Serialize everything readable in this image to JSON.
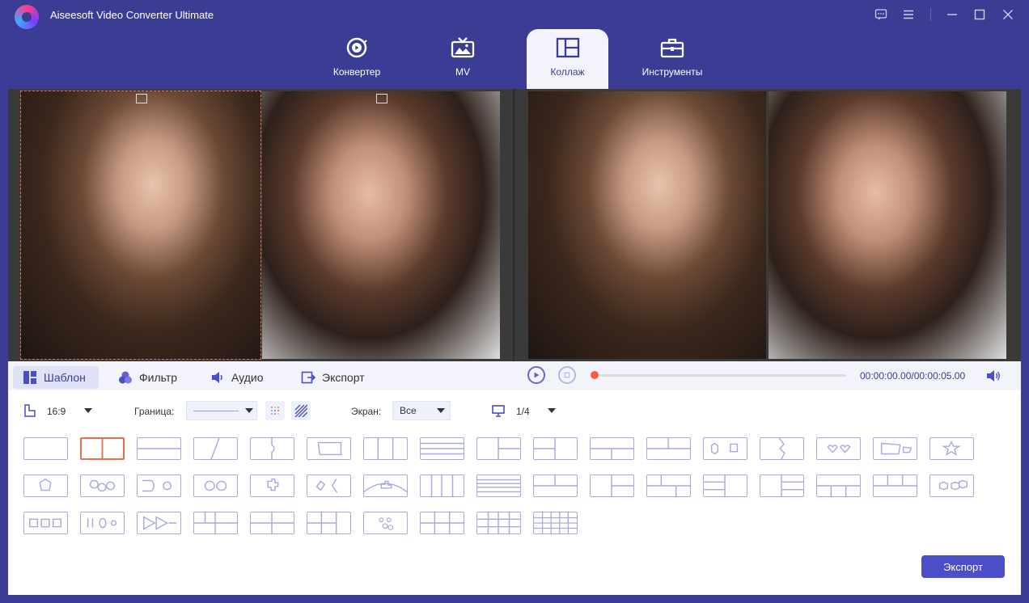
{
  "app": {
    "title": "Aiseesoft Video Converter Ultimate"
  },
  "tabs": [
    {
      "label": "Конвертер",
      "icon": "convert-icon"
    },
    {
      "label": "MV",
      "icon": "tv-image-icon"
    },
    {
      "label": "Коллаж",
      "icon": "collage-icon",
      "active": true
    },
    {
      "label": "Инструменты",
      "icon": "toolbox-icon"
    }
  ],
  "subtabs": [
    {
      "label": "Шаблон",
      "active": true
    },
    {
      "label": "Фильтр"
    },
    {
      "label": "Аудио"
    },
    {
      "label": "Экспорт"
    }
  ],
  "player": {
    "time": "00:00:00.00/00:00:05.00",
    "progress": 0.0
  },
  "toolbar": {
    "aspect": "16:9",
    "border_label": "Граница:",
    "screen_label": "Экран:",
    "screen_value": "Все",
    "page": "1/4"
  },
  "export_button": "Экспорт",
  "templates_count": 45,
  "selected_template": 1
}
